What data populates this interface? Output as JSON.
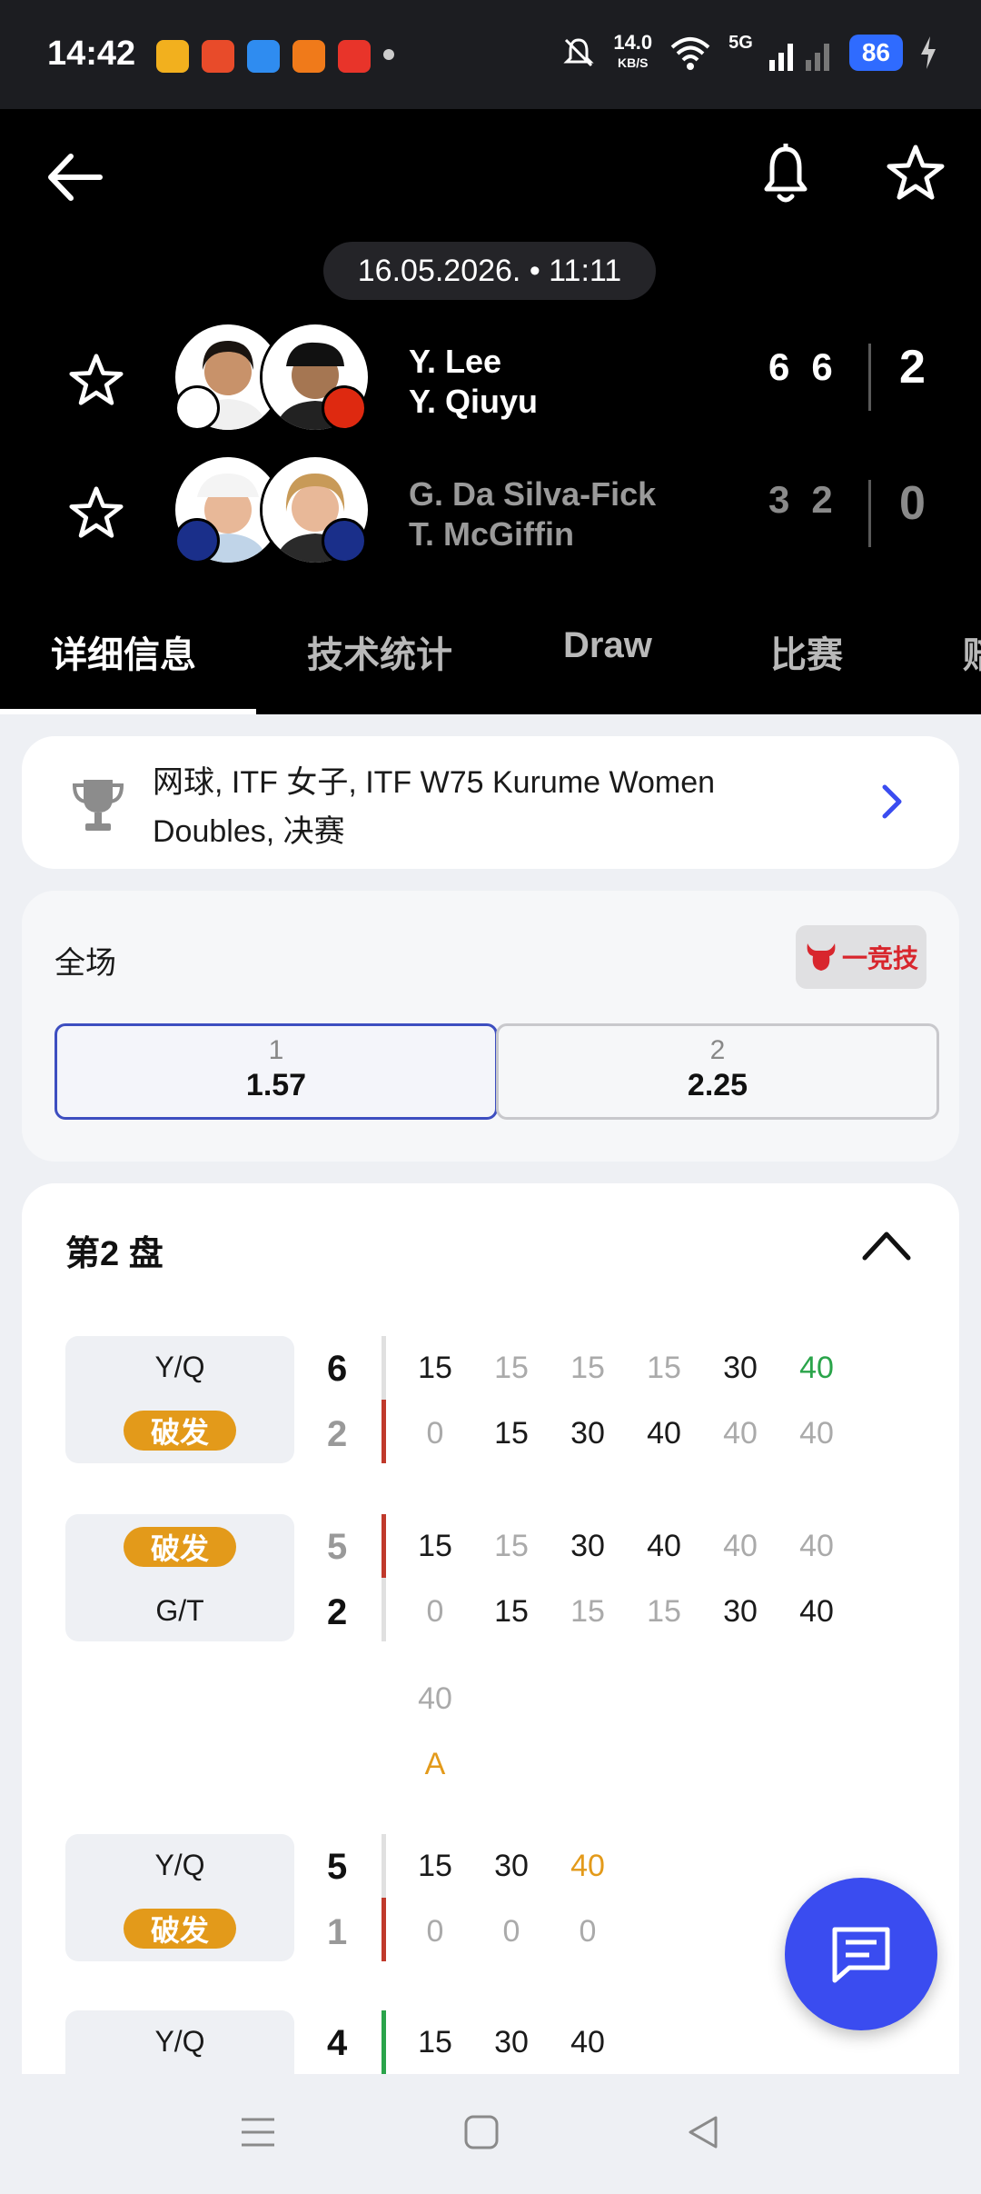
{
  "status_bar": {
    "time": "14:42",
    "speed_value": "14.0",
    "speed_unit": "KB/S",
    "network": "5G",
    "battery": "86",
    "app_icon_colors": [
      "#f2b01e",
      "#e84b2a",
      "#2f8cf0",
      "#f07a1a",
      "#e8342a"
    ]
  },
  "header": {
    "date": "16.05.2026. • 11:11",
    "team1": {
      "player1": "Y. Lee",
      "player2": "Y. Qiuyu",
      "set_scores": [
        "6",
        "6"
      ],
      "sets_won": "2"
    },
    "team2": {
      "player1": "G. Da Silva-Fick",
      "player2": "T. McGiffin",
      "set_scores": [
        "3",
        "2"
      ],
      "sets_won": "0"
    }
  },
  "tabs": [
    {
      "label": "详细信息"
    },
    {
      "label": "技术统计"
    },
    {
      "label": "Draw"
    },
    {
      "label": "比赛"
    },
    {
      "label": "赔"
    }
  ],
  "competition": {
    "line1": "网球, ITF 女子, ITF W75 Kurume Women",
    "line2": "Doubles, 决赛"
  },
  "odds": {
    "label": "全场",
    "brand": "一竞技",
    "options": [
      {
        "name": "1",
        "value": "1.57"
      },
      {
        "name": "2",
        "value": "2.25"
      }
    ]
  },
  "set_section": {
    "title": "第2 盘",
    "break_label": "破发",
    "games": [
      {
        "top_label": "Y/Q",
        "bottom_label": "破发",
        "top_score": "6",
        "bottom_score": "2",
        "top_points": [
          "15",
          "15",
          "15",
          "15",
          "30",
          "40"
        ],
        "bottom_points": [
          "0",
          "15",
          "30",
          "40",
          "40",
          "40"
        ]
      },
      {
        "top_label": "破发",
        "bottom_label": "G/T",
        "top_score": "5",
        "bottom_score": "2",
        "top_points": [
          "15",
          "15",
          "30",
          "40",
          "40",
          "40"
        ],
        "bottom_points": [
          "0",
          "15",
          "15",
          "15",
          "30",
          "40"
        ],
        "extra_top": "40",
        "extra_bottom": "A"
      },
      {
        "top_label": "Y/Q",
        "bottom_label": "破发",
        "top_score": "5",
        "bottom_score": "1",
        "top_points": [
          "15",
          "30",
          "40"
        ],
        "bottom_points": [
          "0",
          "0",
          "0"
        ]
      },
      {
        "top_label": "Y/Q",
        "top_score": "4",
        "top_points": [
          "15",
          "30",
          "40"
        ]
      }
    ]
  }
}
